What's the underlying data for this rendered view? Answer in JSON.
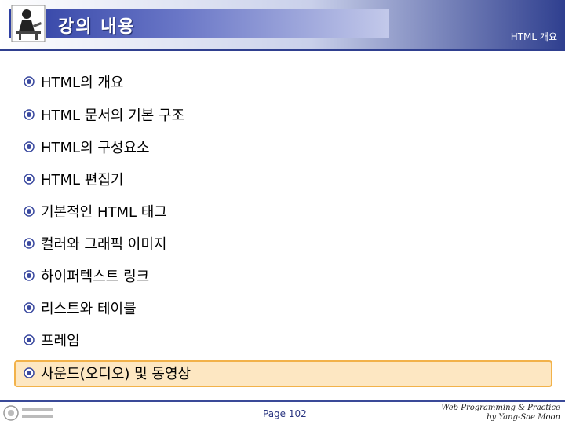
{
  "header": {
    "title": "강의 내용",
    "subtitle": "HTML 개요"
  },
  "items": [
    {
      "label": "HTML의 개요"
    },
    {
      "label": "HTML 문서의 기본 구조"
    },
    {
      "label": "HTML의 구성요소"
    },
    {
      "label": "HTML 편집기"
    },
    {
      "label": "기본적인 HTML 태그"
    },
    {
      "label": "컬러와 그래픽 이미지"
    },
    {
      "label": "하이퍼텍스트 링크"
    },
    {
      "label": "리스트와 테이블"
    },
    {
      "label": "프레임"
    },
    {
      "label": "사운드(오디오) 및 동영상"
    }
  ],
  "footer": {
    "page": "Page 102",
    "credit_line1": "Web Programming & Practice",
    "credit_line2": "by Yang-Sae Moon"
  },
  "icons": {
    "bullet": "university-emblem-bullet-icon",
    "header_logo": "person-at-desk-icon",
    "footer_logo": "university-logo-icon"
  },
  "colors": {
    "title_bar": "#2e3fa3",
    "header_accent": "#2f3f8f",
    "highlight_fill": "#fde7c2",
    "highlight_border": "#f2b24a"
  }
}
